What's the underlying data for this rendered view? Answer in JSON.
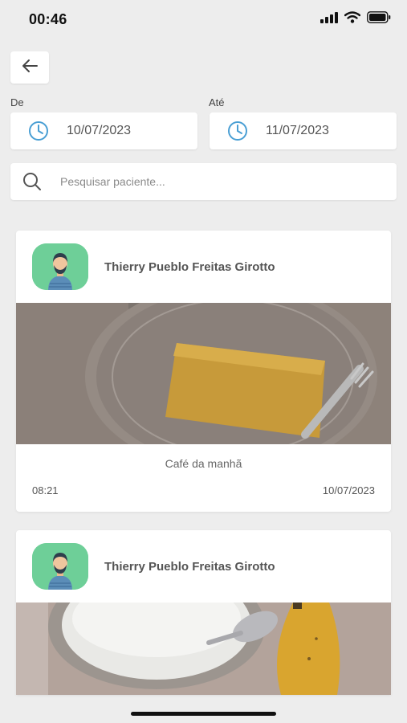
{
  "status_bar": {
    "time": "00:46",
    "icons": [
      "signal-icon",
      "wifi-icon",
      "battery-icon"
    ]
  },
  "nav": {
    "back_icon": "arrow-left-icon"
  },
  "filters": {
    "from_label": "De",
    "from_value": "10/07/2023",
    "to_label": "Até",
    "to_value": "11/07/2023",
    "date_icon": "clock-icon"
  },
  "search": {
    "placeholder": "Pesquisar paciente...",
    "value": ""
  },
  "colors": {
    "background": "#ededed",
    "card": "#ffffff",
    "avatar": "#6ecf98",
    "icon_blue": "#4a9fd4"
  },
  "meals": [
    {
      "patient_name": "Thierry Pueblo Freitas Girotto",
      "photo": "cake-slice-on-glass-plate",
      "meal_type": "Café da manhã",
      "time": "08:21",
      "date": "10/07/2023"
    },
    {
      "patient_name": "Thierry Pueblo Freitas Girotto",
      "photo": "glass-of-milk-and-banana"
    }
  ]
}
